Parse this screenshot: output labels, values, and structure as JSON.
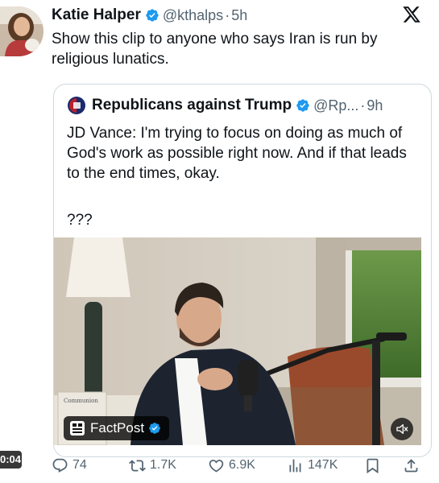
{
  "tweet": {
    "author_name": "Katie Halper",
    "handle": "@kthalps",
    "separator": "·",
    "time": "5h",
    "text": "Show this clip to anyone who says Iran is run by religious lunatics."
  },
  "quoted_tweet": {
    "author_name": "Republicans against Trump",
    "handle": "@Rp...",
    "separator": "·",
    "time": "9h",
    "text": "JD Vance: I'm trying to focus on doing as much of God's work as possible right now. And if that leads to the end times, okay.",
    "text_2": "???",
    "video": {
      "watermark": "FactPost",
      "duration": "0:04",
      "book_title": "Communion"
    }
  },
  "actions": {
    "replies": "74",
    "reposts": "1.7K",
    "likes": "6.9K",
    "views": "147K"
  },
  "icons": {
    "brand": "x-logo-icon",
    "verified": "verified-badge-icon",
    "reply": "reply-icon",
    "repost": "repost-icon",
    "like": "heart-icon",
    "views": "views-icon",
    "bookmark": "bookmark-icon",
    "share": "share-icon",
    "mute": "speaker-muted-icon"
  },
  "colors": {
    "verified_blue": "#1d9bf0",
    "secondary_text": "#536471",
    "primary_text": "#0f1419",
    "border": "#cfd9de"
  }
}
